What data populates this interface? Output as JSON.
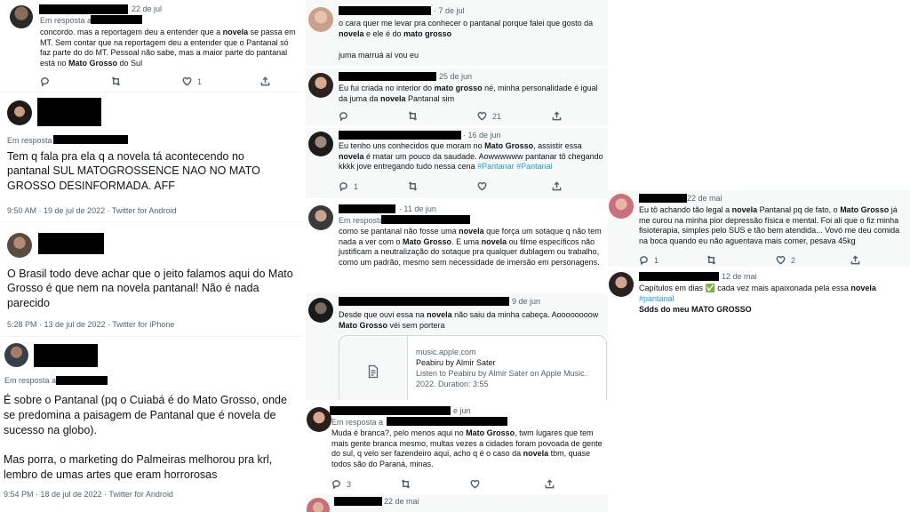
{
  "tweets": {
    "t1": {
      "date": "22 de jul",
      "reply_label": "Em resposta a",
      "text": "concordo. mas a reportagem deu a entender que a novela se passa em MT. Sem contar que na reportagem deu a entender que o Pantanal só faz parte do do MT. Pessoal não sabe, mas a maior parte do pantanal está no Mato Grosso do Sul",
      "likes": "1"
    },
    "t2": {
      "reply_label": "Em resposta",
      "text": "Tem q fala pra ela q a novela tá acontecendo no pantanal SUL MATOGROSSENCE NAO NO MATO GROSSO DESINFORMADA. AFF",
      "meta": "9:50 AM · 19 de jul de 2022 · Twitter for Android"
    },
    "t3": {
      "text": "O Brasil todo deve achar que o jeito falamos aqui do Mato Grosso é que nem na novela pantanal! Não é nada parecido",
      "meta": "5:28 PM · 13 de jul de 2022 · Twitter for iPhone"
    },
    "t4": {
      "reply_label": "Em resposta a",
      "text1": "É sobre o Pantanal (pq o Cuiabá é do Mato Grosso, onde se predomina a paisagem de Pantanal que é novela de sucesso na globo).",
      "text2": "Mas porra, o marketing do Palmeiras melhorou pra krl, lembro de umas artes que eram horrorosas",
      "meta": "9:54 PM · 18 de jul de 2022 · Twitter for Android"
    },
    "m1": {
      "date": "· 7 de jul",
      "text": "o cara quer me levar pra conhecer o pantanal porque falei que gosto da novela e ele é do mato grosso",
      "text2": "juma marruá aí vou eu"
    },
    "m2": {
      "date": "25 de jun",
      "text": "Eu fui criada no interior do mato grosso né, minha personalidade é igual da juma da novela Pantanal sim",
      "likes": "21"
    },
    "m3": {
      "date": "· 16 de jun",
      "text": "Eu tenho uns conhecidos que moram no Mato Grosso, assistir essa novela é matar um pouco da saudade. Aowwwww pantanar tô chegando kkkk jove entregando tudo nessa cena",
      "hashtags": "#Pantanar #Pantanal",
      "replies": "1"
    },
    "m4": {
      "date": "· 11 de jun",
      "reply_label": "Em resposta",
      "text": "como se pantanal não fosse uma novela que força um sotaque q não tem nada a ver com o Mato Grosso. E uma novela ou filme específicos não justificam a neutralização do sotaque pra qualquer dublagem ou trabalho, como um padrão, mesmo sem necessidade de imersão em personagens."
    },
    "m5": {
      "date": "9 de jun",
      "text": "Desde que ouvi essa na novela não saiu da minha cabeça. Aooooooow Mato Grosso véi sem portera",
      "link_domain": "music.apple.com",
      "link_title": "Peabiru by Almir Sater",
      "link_desc": "Listen to Peabiru by Almir Sater on Apple Music. 2022. Duration: 3:55"
    },
    "m6": {
      "date": "e jun",
      "reply_label": "Em resposta a",
      "text": "Muda é branca?, pelo menos aqui no Mato Grosso, twm lugares que tem mais gente branca mesmo, multas vezes a cidades foram povoada de gente do sul, q velo ser fazendeiro aqui, acho q é o caso da novela tbm, quase todos são do Paraná, minas.",
      "replies": "3"
    },
    "m7": {
      "date": "22 de mai"
    },
    "r1": {
      "date": "22 de mai",
      "text": "Eu tô achando tão legal a novela Pantanal pq de fato, o Mato Grosso já me curou na minha pior depressão física e mental. Foi ali que o fiz minha fisioterapia, simples pelo SUS e tão bem atendida... Vovó me deu comida na boca quando eu não aguentava mais comer, pesava 45kg",
      "replies": "1",
      "likes": "2"
    },
    "r2": {
      "date": "12 de mai",
      "text": "Capítulos em dias ✅ cada vez mais apaixonada pela essa novela",
      "hashtag": "#pantanal",
      "text2": "Sdds do meu MATO GROSSO"
    }
  },
  "icons": [
    "reply-icon",
    "retweet-icon",
    "like-icon",
    "share-icon",
    "document-icon"
  ],
  "colors": {
    "link": "#1d9bf0",
    "muted": "#536471",
    "card_gray": "#f7f9f9"
  }
}
